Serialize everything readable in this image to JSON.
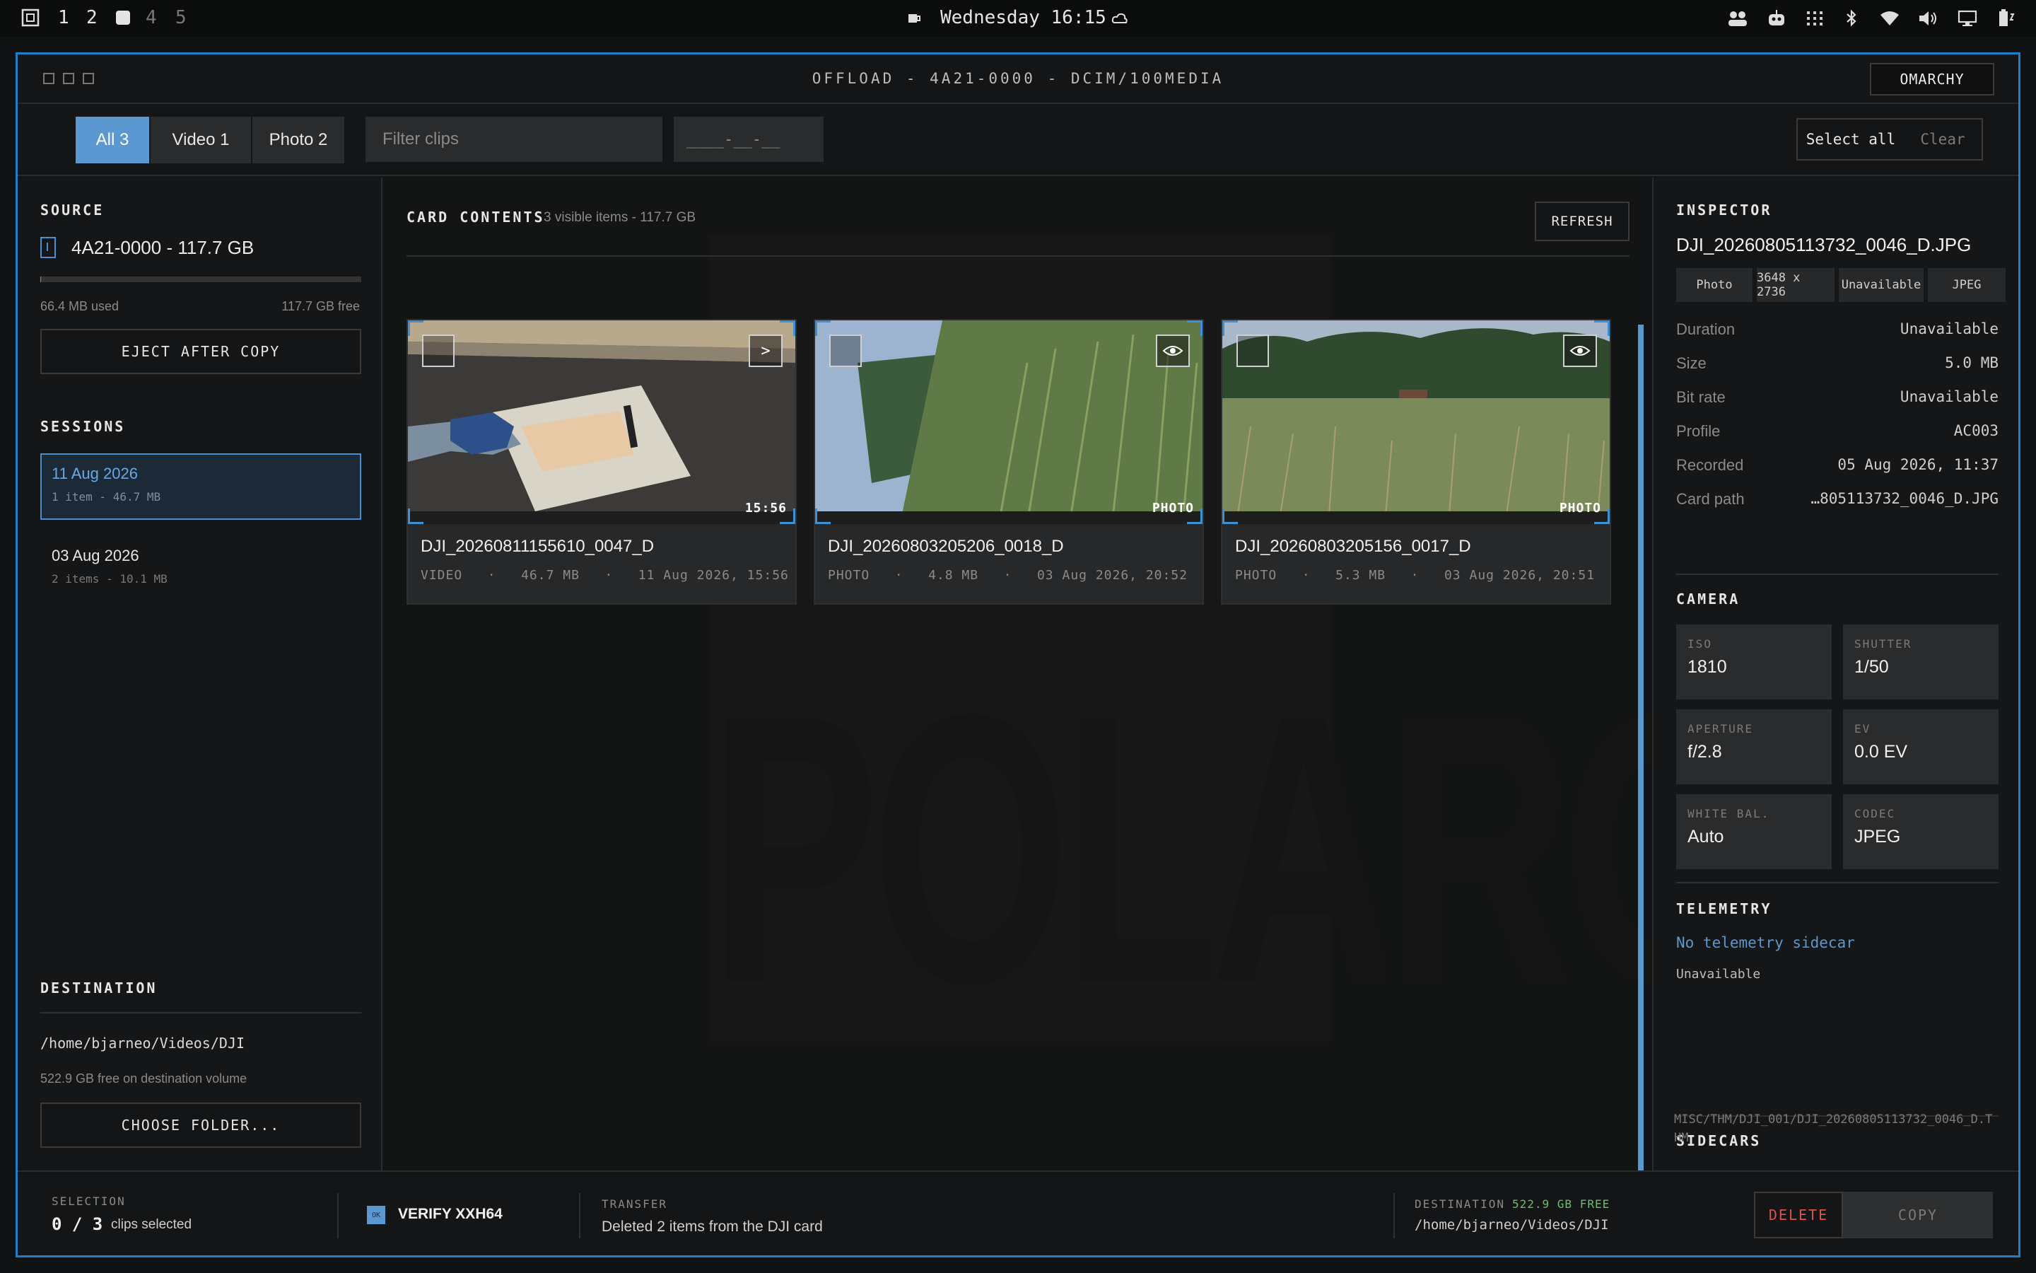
{
  "topbar": {
    "workspaces": [
      "1",
      "2",
      "4",
      "5"
    ],
    "clock": "Wednesday 16:15"
  },
  "window": {
    "title": "OFFLOAD - 4A21-0000 - DCIM/100MEDIA",
    "user_button": "OMARCHY"
  },
  "filterbar": {
    "tabs": [
      {
        "label": "All 3"
      },
      {
        "label": "Video 1"
      },
      {
        "label": "Photo 2"
      }
    ],
    "search_placeholder": "Filter clips",
    "date_placeholder": "____-__-__",
    "select_all": "Select all",
    "clear": "Clear"
  },
  "source": {
    "title": "SOURCE",
    "card": "4A21-0000 - 117.7 GB",
    "used": "66.4 MB used",
    "free": "117.7 GB free",
    "usage_fraction": 0.0006,
    "eject": "EJECT AFTER COPY"
  },
  "sessions": {
    "title": "SESSIONS",
    "items": [
      {
        "date": "11 Aug 2026",
        "meta": "1 item - 46.7 MB"
      },
      {
        "date": "03 Aug 2026",
        "meta": "2 items - 10.1 MB"
      }
    ]
  },
  "destination": {
    "title": "DESTINATION",
    "path": "/home/bjarneo/Videos/DJI",
    "free": "522.9 GB free on destination volume",
    "choose": "CHOOSE FOLDER..."
  },
  "contents": {
    "title": "CARD CONTENTS",
    "summary": "3 visible items - 117.7 GB",
    "refresh": "REFRESH",
    "watermark": "POLAROID",
    "clips": [
      {
        "name": "DJI_20260811155610_0047_D",
        "type": "VIDEO",
        "size": "46.7 MB",
        "date": "11 Aug 2026, 15:56",
        "badge": "15:56",
        "action": ">"
      },
      {
        "name": "DJI_20260803205206_0018_D",
        "type": "PHOTO",
        "size": "4.8 MB",
        "date": "03 Aug 2026, 20:52",
        "badge": "PHOTO",
        "action": "eye"
      },
      {
        "name": "DJI_20260803205156_0017_D",
        "type": "PHOTO",
        "size": "5.3 MB",
        "date": "03 Aug 2026, 20:51",
        "badge": "PHOTO",
        "action": "eye"
      }
    ],
    "separator": "·"
  },
  "inspector": {
    "title": "INSPECTOR",
    "filename": "DJI_20260805113732_0046_D.JPG",
    "chips": [
      "Photo",
      "3648 x 2736",
      "Unavailable",
      "JPEG"
    ],
    "props": [
      {
        "k": "Duration",
        "v": "Unavailable"
      },
      {
        "k": "Size",
        "v": "5.0 MB"
      },
      {
        "k": "Bit rate",
        "v": "Unavailable"
      },
      {
        "k": "Profile",
        "v": "AC003"
      },
      {
        "k": "Recorded",
        "v": "05 Aug 2026, 11:37"
      },
      {
        "k": "Card path",
        "v": "…805113732_0046_D.JPG"
      }
    ],
    "camera_title": "CAMERA",
    "camera": [
      {
        "k": "ISO",
        "v": "1810"
      },
      {
        "k": "SHUTTER",
        "v": "1/50"
      },
      {
        "k": "APERTURE",
        "v": "f/2.8"
      },
      {
        "k": "EV",
        "v": "0.0 EV"
      },
      {
        "k": "WHITE BAL.",
        "v": "Auto"
      },
      {
        "k": "CODEC",
        "v": "JPEG"
      }
    ],
    "telemetry_title": "TELEMETRY",
    "telemetry_status": "No telemetry sidecar",
    "telemetry_value": "Unavailable",
    "sidecars_title": "SIDECARS",
    "sidecar_path": "MISC/THM/DJI_001/DJI_20260805113732_0046_D.THM"
  },
  "bottombar": {
    "selection_label": "SELECTION",
    "selection_count": "0 / 3",
    "selection_text": "clips selected",
    "verify_badge": "OK",
    "verify": "VERIFY XXH64",
    "transfer_label": "TRANSFER",
    "transfer_status": "Deleted 2 items from the DJI card",
    "dest_label": "DESTINATION",
    "dest_free": "522.9 GB FREE",
    "dest_path": "/home/bjarneo/Videos/DJI",
    "delete": "DELETE",
    "copy": "COPY"
  },
  "colors": {
    "accent": "#5b97d1",
    "frame": "#1e7fc4",
    "danger": "#d9534f",
    "free_green": "#6bbf6b"
  }
}
